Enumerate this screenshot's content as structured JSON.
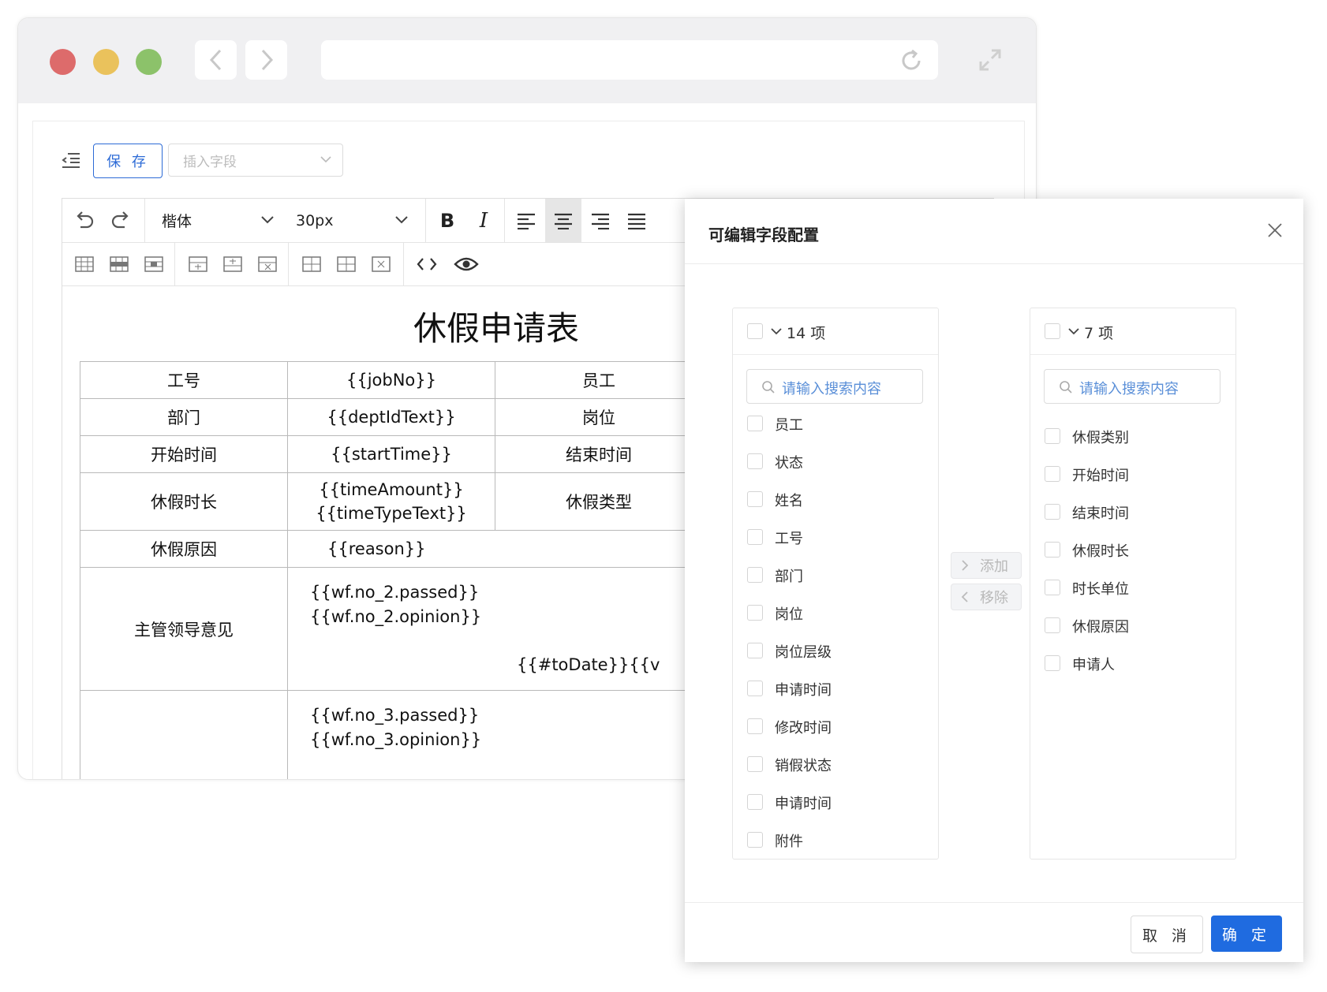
{
  "toolbar": {
    "save_label": "保 存",
    "insert_field_placeholder": "插入字段",
    "font_family": "楷体",
    "font_size": "30px",
    "bold_label": "B",
    "italic_label": "I"
  },
  "document": {
    "title": "休假申请表",
    "rows": [
      {
        "label1": "工号",
        "value1": "{{jobNo}}",
        "label2": "员工"
      },
      {
        "label1": "部门",
        "value1": "{{deptIdText}}",
        "label2": "岗位"
      },
      {
        "label1": "开始时间",
        "value1": "{{startTime}}",
        "label2": "结束时间"
      },
      {
        "label1": "休假时长",
        "value1_line1": "{{timeAmount}}",
        "value1_line2": "{{timeTypeText}}",
        "label2": "休假类型"
      },
      {
        "label1": "休假原因",
        "value1": "{{reason}}"
      },
      {
        "label1": "主管领导意见",
        "line1": "{{wf.no_2.passed}}",
        "line2": "{{wf.no_2.opinion}}",
        "date": "{{#toDate}}{{v"
      },
      {
        "label1": "",
        "line1": "{{wf.no_3.passed}}",
        "line2": "{{wf.no_3.opinion}}"
      }
    ]
  },
  "modal": {
    "title": "可编辑字段配置",
    "left": {
      "count": "14 项",
      "search_placeholder": "请输入搜索内容",
      "items": [
        "员工",
        "状态",
        "姓名",
        "工号",
        "部门",
        "岗位",
        "岗位层级",
        "申请时间",
        "修改时间",
        "销假状态",
        "申请时间",
        "附件"
      ]
    },
    "right": {
      "count": "7 项",
      "search_placeholder": "请输入搜索内容",
      "items": [
        "休假类别",
        "开始时间",
        "结束时间",
        "休假时长",
        "时长单位",
        "休假原因",
        "申请人"
      ]
    },
    "add_label": "添加",
    "remove_label": "移除",
    "cancel_label": "取 消",
    "ok_label": "确 定"
  },
  "colors": {
    "accent": "#1f6be0",
    "save_border": "#2d6bd6",
    "placeholder_blue": "#5a8fd8"
  }
}
